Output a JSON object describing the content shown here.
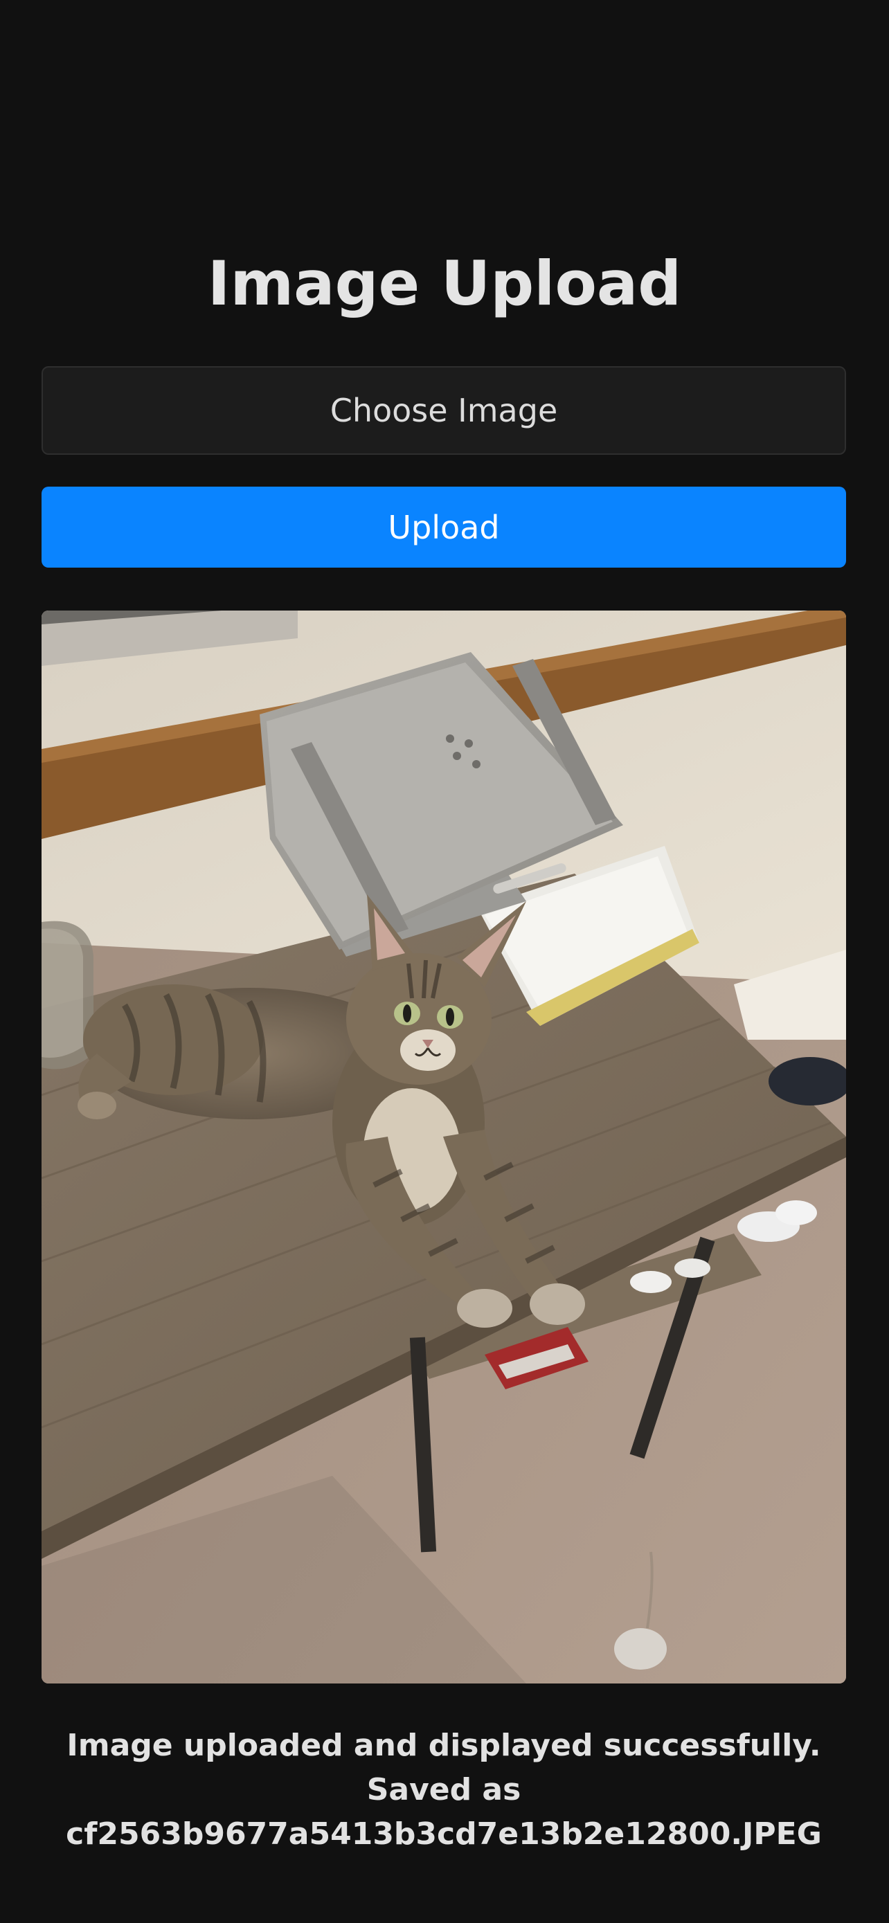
{
  "page": {
    "title": "Image Upload"
  },
  "controls": {
    "choose_label": "Choose Image",
    "upload_label": "Upload"
  },
  "preview": {
    "subject": "cat-on-desk-photo"
  },
  "status": {
    "message": "Image uploaded and displayed successfully. Saved as cf2563b9677a5413b3cd7e13b2e12800.JPEG"
  },
  "colors": {
    "background": "#111111",
    "primary_button": "#0a84ff",
    "secondary_button": "#1c1c1c",
    "text": "#e4e4e4"
  }
}
